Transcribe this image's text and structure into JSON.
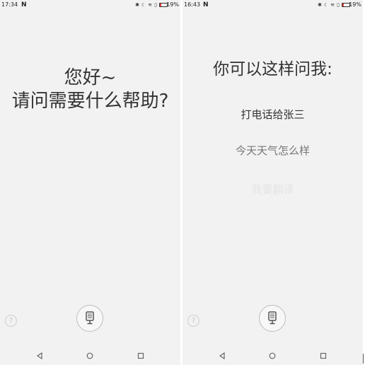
{
  "left_screen": {
    "status": {
      "time": "17:34",
      "carrier_icon": "N",
      "battery_percent": "19%"
    },
    "greeting_line1": "您好~",
    "greeting_line2": "请问需要什么帮助?",
    "help_label": "?",
    "mic_icon": "microphone-icon"
  },
  "right_screen": {
    "status": {
      "time": "16:43",
      "carrier_icon": "N",
      "battery_percent": "19%"
    },
    "hint_title": "你可以这样问我:",
    "hints": [
      "打电话给张三",
      "今天天气怎么样",
      "我要翻译"
    ],
    "help_label": "?",
    "mic_icon": "microphone-icon"
  },
  "colors": {
    "background": "#f2f2f2",
    "text_primary": "#333333",
    "text_secondary": "#777777",
    "text_faded": "#e4e4e4",
    "battery_low": "#e53935"
  },
  "battery_level": 0.19
}
